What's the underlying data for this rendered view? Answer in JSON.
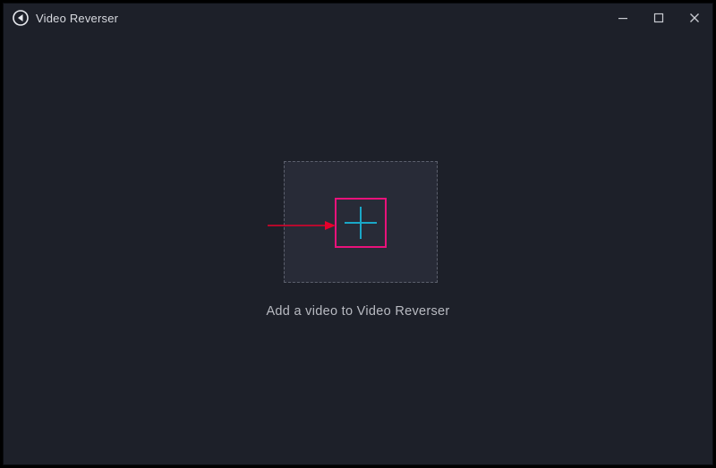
{
  "titlebar": {
    "app_name": "Video Reverser"
  },
  "main": {
    "add_video_caption": "Add a video to Video Reverser"
  },
  "colors": {
    "background": "#1d2029",
    "dropzone_fill": "#282b37",
    "dropzone_border": "#5c606d",
    "highlight_box": "#e9127b",
    "plus_icon": "#1aa7c7",
    "arrow": "#e6002b",
    "text_primary": "#d8dae0",
    "text_secondary": "#b8bac1"
  }
}
